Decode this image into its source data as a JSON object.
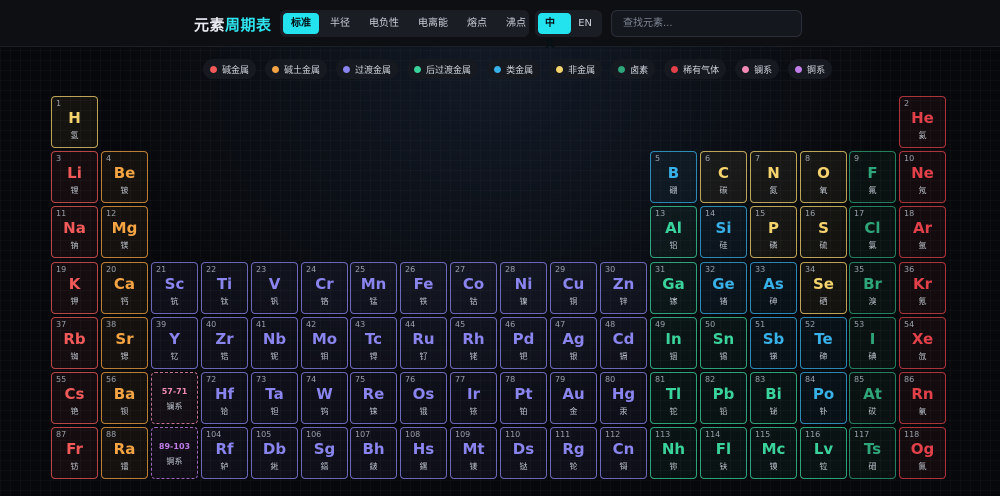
{
  "header": {
    "brand_plain": "元素",
    "brand_accent": "周期表",
    "modes": [
      "标准",
      "半径",
      "电负性",
      "电离能",
      "熔点",
      "沸点"
    ],
    "active_mode": 0,
    "langs": [
      "中文",
      "EN"
    ],
    "active_lang": 0,
    "search_placeholder": "查找元素..."
  },
  "legend": [
    {
      "label": "碱金属",
      "cat": "alkali"
    },
    {
      "label": "碱土金属",
      "cat": "alkaline"
    },
    {
      "label": "过渡金属",
      "cat": "transition"
    },
    {
      "label": "后过渡金属",
      "cat": "post"
    },
    {
      "label": "类金属",
      "cat": "metalloid"
    },
    {
      "label": "非金属",
      "cat": "nonmetal"
    },
    {
      "label": "卤素",
      "cat": "halogen"
    },
    {
      "label": "稀有气体",
      "cat": "noble"
    },
    {
      "label": "镧系",
      "cat": "lanthanide"
    },
    {
      "label": "锕系",
      "cat": "actinide"
    }
  ],
  "colors": {
    "alkali": "#f25a5a",
    "alkaline": "#f5a443",
    "transition": "#8a84ef",
    "post": "#39d39b",
    "metalloid": "#38b0e8",
    "nonmetal": "#f5d46e",
    "halogen": "#2fa67a",
    "noble": "#e2414a",
    "lanthanide": "#f08ab4",
    "actinide": "#c27ee8"
  },
  "elements": [
    {
      "n": "1",
      "s": "H",
      "name": "氢",
      "cat": "nonmetal",
      "col": 1,
      "row": 1
    },
    {
      "n": "2",
      "s": "He",
      "name": "氦",
      "cat": "noble",
      "col": 18,
      "row": 1
    },
    {
      "n": "3",
      "s": "Li",
      "name": "锂",
      "cat": "alkali",
      "col": 1,
      "row": 2
    },
    {
      "n": "4",
      "s": "Be",
      "name": "铍",
      "cat": "alkaline",
      "col": 2,
      "row": 2
    },
    {
      "n": "5",
      "s": "B",
      "name": "硼",
      "cat": "metalloid",
      "col": 13,
      "row": 2
    },
    {
      "n": "6",
      "s": "C",
      "name": "碳",
      "cat": "nonmetal",
      "col": 14,
      "row": 2
    },
    {
      "n": "7",
      "s": "N",
      "name": "氮",
      "cat": "nonmetal",
      "col": 15,
      "row": 2
    },
    {
      "n": "8",
      "s": "O",
      "name": "氧",
      "cat": "nonmetal",
      "col": 16,
      "row": 2
    },
    {
      "n": "9",
      "s": "F",
      "name": "氟",
      "cat": "halogen",
      "col": 17,
      "row": 2
    },
    {
      "n": "10",
      "s": "Ne",
      "name": "氖",
      "cat": "noble",
      "col": 18,
      "row": 2
    },
    {
      "n": "11",
      "s": "Na",
      "name": "钠",
      "cat": "alkali",
      "col": 1,
      "row": 3
    },
    {
      "n": "12",
      "s": "Mg",
      "name": "镁",
      "cat": "alkaline",
      "col": 2,
      "row": 3
    },
    {
      "n": "13",
      "s": "Al",
      "name": "铝",
      "cat": "post",
      "col": 13,
      "row": 3
    },
    {
      "n": "14",
      "s": "Si",
      "name": "硅",
      "cat": "metalloid",
      "col": 14,
      "row": 3
    },
    {
      "n": "15",
      "s": "P",
      "name": "磷",
      "cat": "nonmetal",
      "col": 15,
      "row": 3
    },
    {
      "n": "16",
      "s": "S",
      "name": "硫",
      "cat": "nonmetal",
      "col": 16,
      "row": 3
    },
    {
      "n": "17",
      "s": "Cl",
      "name": "氯",
      "cat": "halogen",
      "col": 17,
      "row": 3
    },
    {
      "n": "18",
      "s": "Ar",
      "name": "氩",
      "cat": "noble",
      "col": 18,
      "row": 3
    },
    {
      "n": "19",
      "s": "K",
      "name": "钾",
      "cat": "alkali",
      "col": 1,
      "row": 4
    },
    {
      "n": "20",
      "s": "Ca",
      "name": "钙",
      "cat": "alkaline",
      "col": 2,
      "row": 4
    },
    {
      "n": "21",
      "s": "Sc",
      "name": "钪",
      "cat": "transition",
      "col": 3,
      "row": 4
    },
    {
      "n": "22",
      "s": "Ti",
      "name": "钛",
      "cat": "transition",
      "col": 4,
      "row": 4
    },
    {
      "n": "23",
      "s": "V",
      "name": "钒",
      "cat": "transition",
      "col": 5,
      "row": 4
    },
    {
      "n": "24",
      "s": "Cr",
      "name": "铬",
      "cat": "transition",
      "col": 6,
      "row": 4
    },
    {
      "n": "25",
      "s": "Mn",
      "name": "锰",
      "cat": "transition",
      "col": 7,
      "row": 4
    },
    {
      "n": "26",
      "s": "Fe",
      "name": "铁",
      "cat": "transition",
      "col": 8,
      "row": 4
    },
    {
      "n": "27",
      "s": "Co",
      "name": "钴",
      "cat": "transition",
      "col": 9,
      "row": 4
    },
    {
      "n": "28",
      "s": "Ni",
      "name": "镍",
      "cat": "transition",
      "col": 10,
      "row": 4
    },
    {
      "n": "29",
      "s": "Cu",
      "name": "铜",
      "cat": "transition",
      "col": 11,
      "row": 4
    },
    {
      "n": "30",
      "s": "Zn",
      "name": "锌",
      "cat": "transition",
      "col": 12,
      "row": 4
    },
    {
      "n": "31",
      "s": "Ga",
      "name": "镓",
      "cat": "post",
      "col": 13,
      "row": 4
    },
    {
      "n": "32",
      "s": "Ge",
      "name": "锗",
      "cat": "metalloid",
      "col": 14,
      "row": 4
    },
    {
      "n": "33",
      "s": "As",
      "name": "砷",
      "cat": "metalloid",
      "col": 15,
      "row": 4
    },
    {
      "n": "34",
      "s": "Se",
      "name": "硒",
      "cat": "nonmetal",
      "col": 16,
      "row": 4
    },
    {
      "n": "35",
      "s": "Br",
      "name": "溴",
      "cat": "halogen",
      "col": 17,
      "row": 4
    },
    {
      "n": "36",
      "s": "Kr",
      "name": "氪",
      "cat": "noble",
      "col": 18,
      "row": 4
    },
    {
      "n": "37",
      "s": "Rb",
      "name": "铷",
      "cat": "alkali",
      "col": 1,
      "row": 5
    },
    {
      "n": "38",
      "s": "Sr",
      "name": "锶",
      "cat": "alkaline",
      "col": 2,
      "row": 5
    },
    {
      "n": "39",
      "s": "Y",
      "name": "钇",
      "cat": "transition",
      "col": 3,
      "row": 5
    },
    {
      "n": "40",
      "s": "Zr",
      "name": "锆",
      "cat": "transition",
      "col": 4,
      "row": 5
    },
    {
      "n": "41",
      "s": "Nb",
      "name": "铌",
      "cat": "transition",
      "col": 5,
      "row": 5
    },
    {
      "n": "42",
      "s": "Mo",
      "name": "钼",
      "cat": "transition",
      "col": 6,
      "row": 5
    },
    {
      "n": "43",
      "s": "Tc",
      "name": "锝",
      "cat": "transition",
      "col": 7,
      "row": 5
    },
    {
      "n": "44",
      "s": "Ru",
      "name": "钌",
      "cat": "transition",
      "col": 8,
      "row": 5
    },
    {
      "n": "45",
      "s": "Rh",
      "name": "铑",
      "cat": "transition",
      "col": 9,
      "row": 5
    },
    {
      "n": "46",
      "s": "Pd",
      "name": "钯",
      "cat": "transition",
      "col": 10,
      "row": 5
    },
    {
      "n": "47",
      "s": "Ag",
      "name": "银",
      "cat": "transition",
      "col": 11,
      "row": 5
    },
    {
      "n": "48",
      "s": "Cd",
      "name": "镉",
      "cat": "transition",
      "col": 12,
      "row": 5
    },
    {
      "n": "49",
      "s": "In",
      "name": "铟",
      "cat": "post",
      "col": 13,
      "row": 5
    },
    {
      "n": "50",
      "s": "Sn",
      "name": "锡",
      "cat": "post",
      "col": 14,
      "row": 5
    },
    {
      "n": "51",
      "s": "Sb",
      "name": "锑",
      "cat": "metalloid",
      "col": 15,
      "row": 5
    },
    {
      "n": "52",
      "s": "Te",
      "name": "碲",
      "cat": "metalloid",
      "col": 16,
      "row": 5
    },
    {
      "n": "53",
      "s": "I",
      "name": "碘",
      "cat": "halogen",
      "col": 17,
      "row": 5
    },
    {
      "n": "54",
      "s": "Xe",
      "name": "氙",
      "cat": "noble",
      "col": 18,
      "row": 5
    },
    {
      "n": "55",
      "s": "Cs",
      "name": "铯",
      "cat": "alkali",
      "col": 1,
      "row": 6
    },
    {
      "n": "56",
      "s": "Ba",
      "name": "钡",
      "cat": "alkaline",
      "col": 2,
      "row": 6
    },
    {
      "n": "72",
      "s": "Hf",
      "name": "铪",
      "cat": "transition",
      "col": 4,
      "row": 6
    },
    {
      "n": "73",
      "s": "Ta",
      "name": "钽",
      "cat": "transition",
      "col": 5,
      "row": 6
    },
    {
      "n": "74",
      "s": "W",
      "name": "钨",
      "cat": "transition",
      "col": 6,
      "row": 6
    },
    {
      "n": "75",
      "s": "Re",
      "name": "铼",
      "cat": "transition",
      "col": 7,
      "row": 6
    },
    {
      "n": "76",
      "s": "Os",
      "name": "锇",
      "cat": "transition",
      "col": 8,
      "row": 6
    },
    {
      "n": "77",
      "s": "Ir",
      "name": "铱",
      "cat": "transition",
      "col": 9,
      "row": 6
    },
    {
      "n": "78",
      "s": "Pt",
      "name": "铂",
      "cat": "transition",
      "col": 10,
      "row": 6
    },
    {
      "n": "79",
      "s": "Au",
      "name": "金",
      "cat": "transition",
      "col": 11,
      "row": 6
    },
    {
      "n": "80",
      "s": "Hg",
      "name": "汞",
      "cat": "transition",
      "col": 12,
      "row": 6
    },
    {
      "n": "81",
      "s": "Tl",
      "name": "铊",
      "cat": "post",
      "col": 13,
      "row": 6
    },
    {
      "n": "82",
      "s": "Pb",
      "name": "铅",
      "cat": "post",
      "col": 14,
      "row": 6
    },
    {
      "n": "83",
      "s": "Bi",
      "name": "铋",
      "cat": "post",
      "col": 15,
      "row": 6
    },
    {
      "n": "84",
      "s": "Po",
      "name": "钋",
      "cat": "metalloid",
      "col": 16,
      "row": 6
    },
    {
      "n": "85",
      "s": "At",
      "name": "砹",
      "cat": "halogen",
      "col": 17,
      "row": 6
    },
    {
      "n": "86",
      "s": "Rn",
      "name": "氡",
      "cat": "noble",
      "col": 18,
      "row": 6
    },
    {
      "n": "87",
      "s": "Fr",
      "name": "钫",
      "cat": "alkali",
      "col": 1,
      "row": 7
    },
    {
      "n": "88",
      "s": "Ra",
      "name": "镭",
      "cat": "alkaline",
      "col": 2,
      "row": 7
    },
    {
      "n": "104",
      "s": "Rf",
      "name": "轳",
      "cat": "transition",
      "col": 4,
      "row": 7
    },
    {
      "n": "105",
      "s": "Db",
      "name": "𨧀",
      "cat": "transition",
      "col": 5,
      "row": 7
    },
    {
      "n": "106",
      "s": "Sg",
      "name": "𨭎",
      "cat": "transition",
      "col": 6,
      "row": 7
    },
    {
      "n": "107",
      "s": "Bh",
      "name": "𨨏",
      "cat": "transition",
      "col": 7,
      "row": 7
    },
    {
      "n": "108",
      "s": "Hs",
      "name": "𨭆",
      "cat": "transition",
      "col": 8,
      "row": 7
    },
    {
      "n": "109",
      "s": "Mt",
      "name": "鿏",
      "cat": "transition",
      "col": 9,
      "row": 7
    },
    {
      "n": "110",
      "s": "Ds",
      "name": "𫟼",
      "cat": "transition",
      "col": 10,
      "row": 7
    },
    {
      "n": "111",
      "s": "Rg",
      "name": "𬬭",
      "cat": "transition",
      "col": 11,
      "row": 7
    },
    {
      "n": "112",
      "s": "Cn",
      "name": "鿔",
      "cat": "transition",
      "col": 12,
      "row": 7
    },
    {
      "n": "113",
      "s": "Nh",
      "name": "鿭",
      "cat": "post",
      "col": 13,
      "row": 7
    },
    {
      "n": "114",
      "s": "Fl",
      "name": "𫓧",
      "cat": "post",
      "col": 14,
      "row": 7
    },
    {
      "n": "115",
      "s": "Mc",
      "name": "镆",
      "cat": "post",
      "col": 15,
      "row": 7
    },
    {
      "n": "116",
      "s": "Lv",
      "name": "𫟷",
      "cat": "post",
      "col": 16,
      "row": 7
    },
    {
      "n": "117",
      "s": "Ts",
      "name": "鿬",
      "cat": "halogen",
      "col": 17,
      "row": 7
    },
    {
      "n": "118",
      "s": "Og",
      "name": "鿫",
      "cat": "noble",
      "col": 18,
      "row": 7
    }
  ],
  "placeholders": [
    {
      "range": "57-71",
      "name": "镧系",
      "cat": "lanthanide",
      "col": 3,
      "row": 6
    },
    {
      "range": "89-103",
      "name": "锕系",
      "cat": "actinide",
      "col": 3,
      "row": 7
    }
  ]
}
